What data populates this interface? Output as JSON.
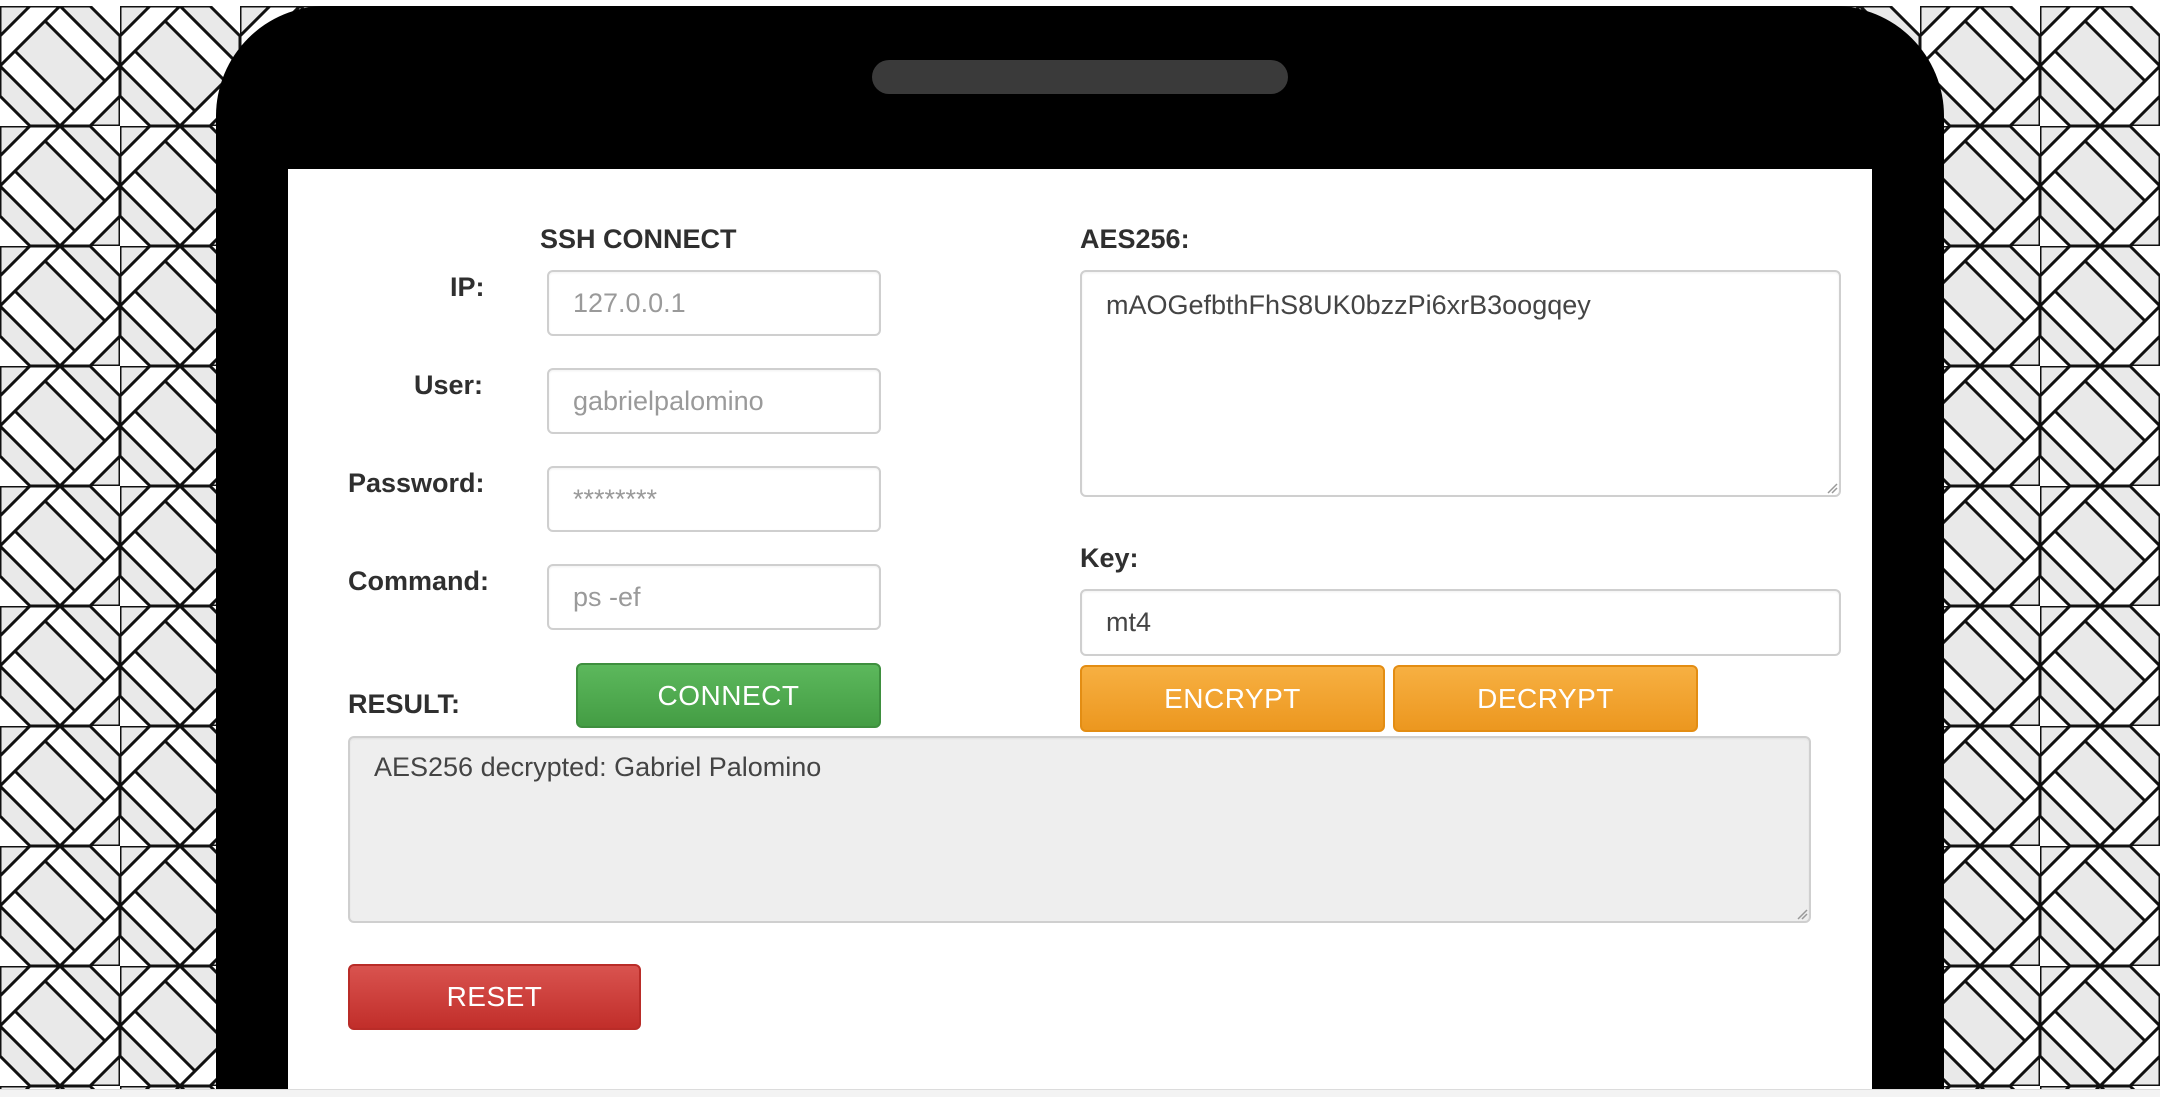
{
  "ssh": {
    "title": "SSH CONNECT",
    "ip_label": "IP:",
    "ip_placeholder": "127.0.0.1",
    "user_label": "User:",
    "user_placeholder": "gabrielpalomino",
    "password_label": "Password:",
    "password_placeholder": "********",
    "command_label": "Command:",
    "command_placeholder": "ps -ef",
    "connect_label": "CONNECT"
  },
  "aes": {
    "title": "AES256:",
    "cipher_text": "mAOGefbthFhS8UK0bzzPi6xrB3oogqey",
    "key_label": "Key:",
    "key_value": "mt4",
    "encrypt_label": "ENCRYPT",
    "decrypt_label": "DECRYPT"
  },
  "result": {
    "label": "RESULT:",
    "text": "AES256 decrypted: Gabriel Palomino",
    "reset_label": "RESET"
  },
  "colors": {
    "connect": "#4cae4c",
    "encrypt": "#f0a030",
    "reset": "#d2322d",
    "phone_frame": "#000000",
    "result_bg": "#eeeeee"
  },
  "icons": {
    "background": "herringbone-pattern",
    "speaker": "speaker-slot"
  }
}
